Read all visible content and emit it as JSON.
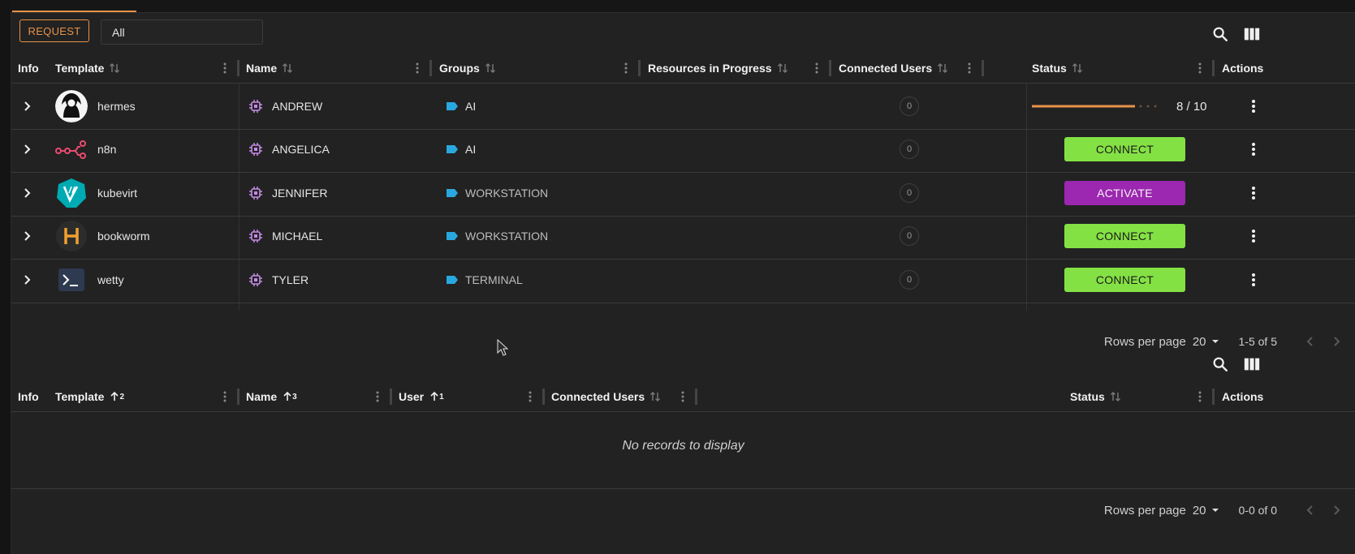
{
  "toolbar": {
    "request_label": "REQUEST",
    "filter_value": "All"
  },
  "table1": {
    "columns": {
      "info": "Info",
      "template": "Template",
      "name": "Name",
      "groups": "Groups",
      "resources": "Resources in Progress",
      "connected": "Connected Users",
      "status": "Status",
      "actions": "Actions"
    },
    "rows": [
      {
        "template": "hermes",
        "logo": "hermes-avatar-icon",
        "name": "ANDREW",
        "group": "AI",
        "connected": "0",
        "status": {
          "type": "progress",
          "label": "8 / 10",
          "value": 0.8
        }
      },
      {
        "template": "n8n",
        "logo": "n8n-logo-icon",
        "name": "ANGELICA",
        "group": "AI",
        "connected": "0",
        "status": {
          "type": "button",
          "label": "CONNECT",
          "color": "#84e144"
        }
      },
      {
        "template": "kubevirt",
        "logo": "kubevirt-logo-icon",
        "name": "JENNIFER",
        "group": "WORKSTATION",
        "connected": "0",
        "status": {
          "type": "button",
          "label": "ACTIVATE",
          "color": "#9c27b0"
        }
      },
      {
        "template": "bookworm",
        "logo": "bookworm-logo-icon",
        "name": "MICHAEL",
        "group": "WORKSTATION",
        "connected": "0",
        "status": {
          "type": "button",
          "label": "CONNECT",
          "color": "#84e144"
        }
      },
      {
        "template": "wetty",
        "logo": "terminal-logo-icon",
        "name": "TYLER",
        "group": "TERMINAL",
        "connected": "0",
        "status": {
          "type": "button",
          "label": "CONNECT",
          "color": "#84e144"
        }
      }
    ],
    "pagination": {
      "rows_per_page_label": "Rows per page",
      "rows_per_page": "20",
      "range": "1-5 of 5"
    }
  },
  "table2": {
    "columns": {
      "info": "Info",
      "template": "Template",
      "template_sort": "2",
      "name": "Name",
      "name_sort": "3",
      "user": "User",
      "user_sort": "1",
      "connected": "Connected Users",
      "status": "Status",
      "actions": "Actions"
    },
    "empty_message": "No records to display",
    "pagination": {
      "rows_per_page_label": "Rows per page",
      "rows_per_page": "20",
      "range": "0-0 of 0"
    }
  },
  "colors": {
    "accent": "#e8924a",
    "connect": "#84e144",
    "activate": "#9c27b0",
    "group_tag": "#29a8e0",
    "chip": "#c58be6"
  }
}
